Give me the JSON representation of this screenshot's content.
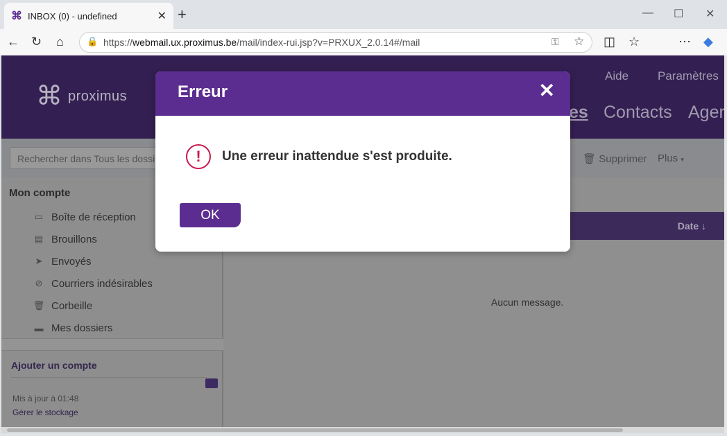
{
  "browser": {
    "tab_title": "INBOX (0) - undefined",
    "url_prefix": "https://",
    "url_host": "webmail.ux.proximus.be",
    "url_path": "/mail/index-rui.jsp?v=PRXUX_2.0.14#/mail"
  },
  "header": {
    "logo_text": "proximus",
    "links": [
      "Aide",
      "Paramètres"
    ],
    "nav": [
      "es",
      "Contacts",
      "Ager"
    ]
  },
  "search": {
    "placeholder": "Rechercher dans Tous les dossiers"
  },
  "actions": {
    "delete": "Supprimer",
    "more": "Plus"
  },
  "sidebar": {
    "heading": "Mon compte",
    "items": [
      {
        "label": "Boîte de réception",
        "icon": "inbox-icon"
      },
      {
        "label": "Brouillons",
        "icon": "draft-icon"
      },
      {
        "label": "Envoyés",
        "icon": "send-icon"
      },
      {
        "label": "Courriers indésirables",
        "icon": "spam-icon"
      },
      {
        "label": "Corbeille",
        "icon": "trash-icon"
      },
      {
        "label": "Mes dossiers",
        "icon": "folder-icon"
      }
    ],
    "add_account": "Ajouter un compte",
    "updated": "Mis à jour à 01:48",
    "manage_storage": "Gérer le stockage"
  },
  "list": {
    "date_header": "Date ↓",
    "empty": "Aucun message."
  },
  "modal": {
    "title": "Erreur",
    "message": "Une erreur inattendue s'est produite.",
    "ok": "OK"
  },
  "colors": {
    "brand": "#5c2d91",
    "alert": "#c9184a"
  }
}
